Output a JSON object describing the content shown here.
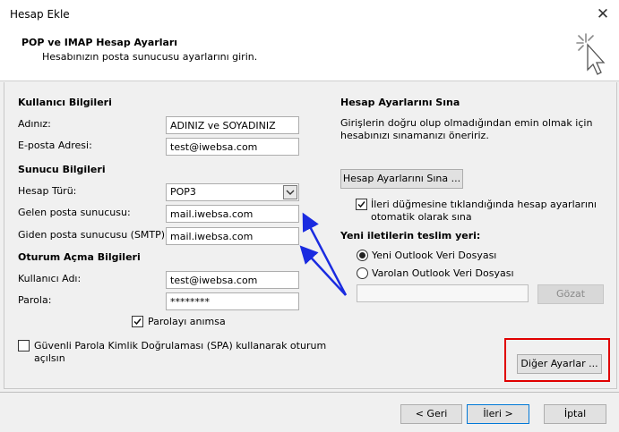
{
  "window": {
    "title": "Hesap Ekle",
    "close_glyph": "✕"
  },
  "header": {
    "title": "POP ve IMAP Hesap Ayarları",
    "subtitle": "Hesabınızın posta sunucusu ayarlarını girin."
  },
  "user_info": {
    "section": "Kullanıcı Bilgileri",
    "name_label": "Adınız:",
    "name_value": "ADINIZ ve SOYADINIZ",
    "email_label": "E-posta Adresi:",
    "email_value": "test@iwebsa.com"
  },
  "server_info": {
    "section": "Sunucu Bilgileri",
    "account_type_label": "Hesap Türü:",
    "account_type_value": "POP3",
    "incoming_label": "Gelen posta sunucusu:",
    "incoming_value": "mail.iwebsa.com",
    "outgoing_label": "Giden posta sunucusu (SMTP):",
    "outgoing_value": "mail.iwebsa.com"
  },
  "login_info": {
    "section": "Oturum Açma Bilgileri",
    "username_label": "Kullanıcı Adı:",
    "username_value": "test@iwebsa.com",
    "password_label": "Parola:",
    "password_value": "********",
    "remember_label": "Parolayı anımsa",
    "spa_label_line1": "Güvenli Parola Kimlik Doğrulaması (SPA) kullanarak oturum",
    "spa_label_line2": "açılsın"
  },
  "test_settings": {
    "section": "Hesap Ayarlarını Sına",
    "desc_line1": "Girişlerin doğru olup olmadığından emin olmak için",
    "desc_line2": "hesabınızı sınamanızı öneririz.",
    "test_button": "Hesap Ayarlarını Sına ...",
    "auto_test_line1": "İleri düğmesine tıklandığında hesap ayarlarını",
    "auto_test_line2": "otomatik olarak sına"
  },
  "delivery": {
    "section": "Yeni iletilerin teslim yeri:",
    "new_file": "Yeni Outlook Veri Dosyası",
    "existing_file": "Varolan Outlook Veri Dosyası",
    "browse_button": "Gözat"
  },
  "more_settings_button": "Diğer Ayarlar ...",
  "footer": {
    "back": "< Geri",
    "next": "İleri >",
    "cancel": "İptal"
  },
  "colors": {
    "highlight": "#e00000",
    "arrow": "#1a2be0",
    "focus": "#0078d7"
  }
}
